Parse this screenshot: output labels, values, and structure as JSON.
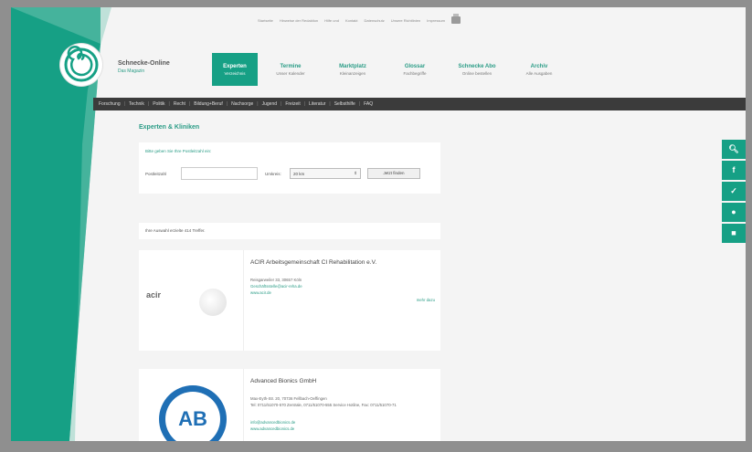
{
  "colors": {
    "brand_green": "#16a085",
    "catbar": "#3b3b3b"
  },
  "topbar": {
    "links": [
      "Startseite",
      "Hinweise der Redaktion",
      "Hilfe und",
      "Kontakt",
      "Datenschutz",
      "Unsere Richtlinien",
      "Impressum"
    ],
    "print_icon": "printer-icon"
  },
  "brand": {
    "title": "Schnecke-Online",
    "subtitle": "Das Magazin"
  },
  "mainnav": [
    {
      "label": "Experten",
      "sub": "Verzeichnis",
      "active": true
    },
    {
      "label": "Termine",
      "sub": "Unser Kalender"
    },
    {
      "label": "Marktplatz",
      "sub": "Kleinanzeigen"
    },
    {
      "label": "Glossar",
      "sub": "Fachbegriffe"
    },
    {
      "label": "Schnecke Abo",
      "sub": "Online bestellen"
    },
    {
      "label": "Archiv",
      "sub": "Alle Ausgaben"
    }
  ],
  "categories": [
    "Forschung",
    "Technik",
    "Politik",
    "Recht",
    "Bildung+Beruf",
    "Nachsorge",
    "Jugend",
    "Freizeit",
    "Literatur",
    "Selbsthilfe",
    "FAQ"
  ],
  "page": {
    "heading": "Experten & Kliniken"
  },
  "search": {
    "prompt": "Bitte geben Sie Ihre Postleitzahl ein:",
    "plz_label": "Postleitzahl",
    "plz_value": "",
    "radius_label": "Umkreis:",
    "radius_value": "20 km",
    "submit_label": "Jetzt finden"
  },
  "results": {
    "info": "Ihre Auswahl erzielte 414 Treffer."
  },
  "entries": [
    {
      "title": "ACIR Arbeitsgemeinschaft CI Rehabilitation e.V.",
      "lines": [
        "Reisgarweiler 33, 30657 Köln",
        "Geschäftsstelle@acir-reha.de",
        "www.acir.de"
      ],
      "more": "mehr dazu",
      "logo_text": "acir"
    },
    {
      "title": "Advanced Bionics GmbH",
      "lines": [
        "Max-Eyth-Str. 20, 70736 Fellbach-Oeffingen",
        "Tel: 0711/51070-570 Zentrale, 0711/51070-555 Service Hotline, Fax: 0711/51070-71",
        "info@advancedbionics.de",
        "www.advancedbionics.de"
      ],
      "logo_text": "AB"
    }
  ],
  "socials": [
    "search-icon",
    "facebook-icon",
    "twitter-icon",
    "comment-icon",
    "chat-icon"
  ],
  "social_glyphs": [
    "🔍︎",
    "f",
    "✓",
    "●",
    "■"
  ]
}
